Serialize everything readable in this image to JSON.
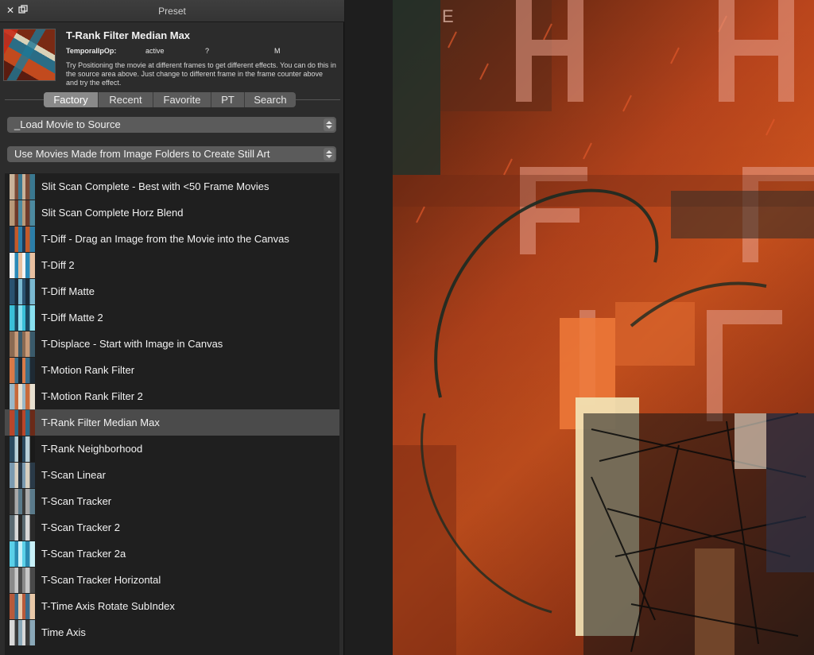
{
  "window": {
    "title": "Preset"
  },
  "preset": {
    "name": "T-Rank Filter Median Max",
    "param_name": "TemporalIpOp:",
    "param_values": [
      "active",
      "?",
      "M"
    ],
    "description": "Try Positioning the movie at different frames to get different effects.  You can do this in the source area above.  Just change to different frame in the frame counter above and try the effect."
  },
  "tabs": [
    {
      "label": "Factory",
      "active": true
    },
    {
      "label": "Recent",
      "active": false
    },
    {
      "label": "Favorite",
      "active": false
    },
    {
      "label": "PT",
      "active": false
    },
    {
      "label": "Search",
      "active": false
    }
  ],
  "source_select": {
    "value": "_Load Movie to Source"
  },
  "category_select": {
    "value": "Use Movies Made from Image Folders to Create Still Art"
  },
  "presets": [
    {
      "label": "Slit Scan Complete - Best with <50 Frame Movies",
      "thumb": [
        "#c9b39a",
        "#7a4a36",
        "#3a7890"
      ]
    },
    {
      "label": "Slit Scan Complete Horz Blend",
      "thumb": [
        "#b89a7a",
        "#6e3a2a",
        "#4c8aa0"
      ]
    },
    {
      "label": "T-Diff - Drag an Image from the Movie into the Canvas",
      "thumb": [
        "#1e3a56",
        "#c45a2a",
        "#2c7ea8"
      ]
    },
    {
      "label": "T-Diff 2",
      "thumb": [
        "#f4f4f4",
        "#2a8ab8",
        "#e8c0a0"
      ]
    },
    {
      "label": "T-Diff Matte",
      "thumb": [
        "#2a5270",
        "#1a2a38",
        "#7ab8d0"
      ]
    },
    {
      "label": "T-Diff Matte 2",
      "thumb": [
        "#3ac0d8",
        "#1a4a60",
        "#88e0f0"
      ]
    },
    {
      "label": "T-Displace - Start with Image in Canvas",
      "thumb": [
        "#8a6a52",
        "#c89a78",
        "#3a5a6a"
      ]
    },
    {
      "label": "T-Motion Rank Filter",
      "thumb": [
        "#d87a48",
        "#3a6e8a",
        "#1e2a34"
      ]
    },
    {
      "label": "T-Motion Rank Filter 2",
      "thumb": [
        "#9ab8c8",
        "#c86a3a",
        "#e8e0d0"
      ]
    },
    {
      "label": "T-Rank Filter Median Max",
      "thumb": [
        "#b8462a",
        "#2a6a88",
        "#6a2a18"
      ],
      "selected": true
    },
    {
      "label": "T-Rank Neighborhood",
      "thumb": [
        "#2a4a60",
        "#b8d0d8",
        "#1a1a1a"
      ]
    },
    {
      "label": "T-Scan Linear",
      "thumb": [
        "#7a9ab0",
        "#d8d0c0",
        "#2a3a48"
      ]
    },
    {
      "label": "T-Scan Tracker",
      "thumb": [
        "#3a3a3a",
        "#a8a8a8",
        "#5a7a8a"
      ]
    },
    {
      "label": "T-Scan Tracker 2",
      "thumb": [
        "#5a6a72",
        "#d8d8d8",
        "#2a2a2a"
      ]
    },
    {
      "label": "T-Scan Tracker 2a",
      "thumb": [
        "#5ad0e8",
        "#2a8ab0",
        "#c8f0f8"
      ]
    },
    {
      "label": "T-Scan Tracker Horizontal",
      "thumb": [
        "#8a8a8a",
        "#c8c8c8",
        "#4a4a4a"
      ]
    },
    {
      "label": "T-Time Axis Rotate SubIndex",
      "thumb": [
        "#b85a3a",
        "#3a6a8a",
        "#e8c8a8"
      ]
    },
    {
      "label": "Time Axis",
      "thumb": [
        "#d8d8d8",
        "#3a3a3a",
        "#8aa8b8"
      ]
    }
  ],
  "colors": {
    "panel_bg": "#2c2c2c",
    "list_bg": "#1f1f1f",
    "selected_row": "#4b4b4b",
    "tab_active": "#8a8a8a"
  }
}
